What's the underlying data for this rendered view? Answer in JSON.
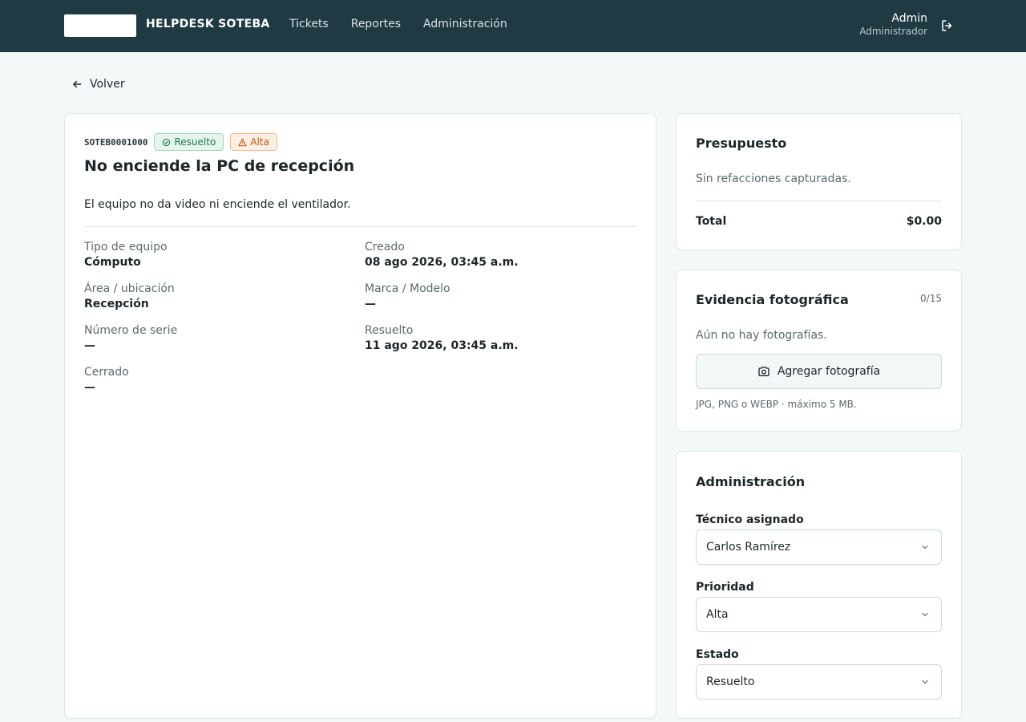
{
  "header": {
    "brand": "HELPDESK SOTEBA",
    "nav": [
      "Tickets",
      "Reportes",
      "Administración"
    ],
    "user_name": "Admin",
    "user_role": "Administrador",
    "logout_icon": "logout-icon"
  },
  "back_label": "Volver",
  "ticket": {
    "code": "SOTEB0001000",
    "status": "Resuelto",
    "priority": "Alta",
    "title": "No enciende la PC de recepción",
    "description": "El equipo no da video ni enciende el ventilador.",
    "fields": {
      "tipo_label": "Tipo de equipo",
      "tipo_value": "Cómputo",
      "area_label": "Área / ubicación",
      "area_value": "Recepción",
      "serie_label": "Número de serie",
      "serie_value": "—",
      "cerrado_label": "Cerrado",
      "cerrado_value": "—",
      "creado_label": "Creado",
      "creado_value": "08 ago 2026, 03:45 a.m.",
      "marca_label": "Marca / Modelo",
      "marca_value": "—",
      "resuelto_label": "Resuelto",
      "resuelto_value": "11 ago 2026, 03:45 a.m."
    }
  },
  "budget": {
    "title": "Presupuesto",
    "empty": "Sin refacciones capturadas.",
    "total_label": "Total",
    "total_value": "$0.00"
  },
  "photos": {
    "title": "Evidencia fotográfica",
    "count": "0/15",
    "empty": "Aún no hay fotografías.",
    "add_label": "Agregar fotografía",
    "hint": "JPG, PNG o WEBP · máximo 5 MB."
  },
  "admin": {
    "title": "Administración",
    "tech_label": "Técnico asignado",
    "tech_value": "Carlos Ramírez",
    "priority_label": "Prioridad",
    "priority_value": "Alta",
    "status_label": "Estado",
    "status_value": "Resuelto"
  },
  "colors": {
    "header_bg": "#203a43",
    "success": "#1f7a46",
    "warning": "#c4560f"
  }
}
